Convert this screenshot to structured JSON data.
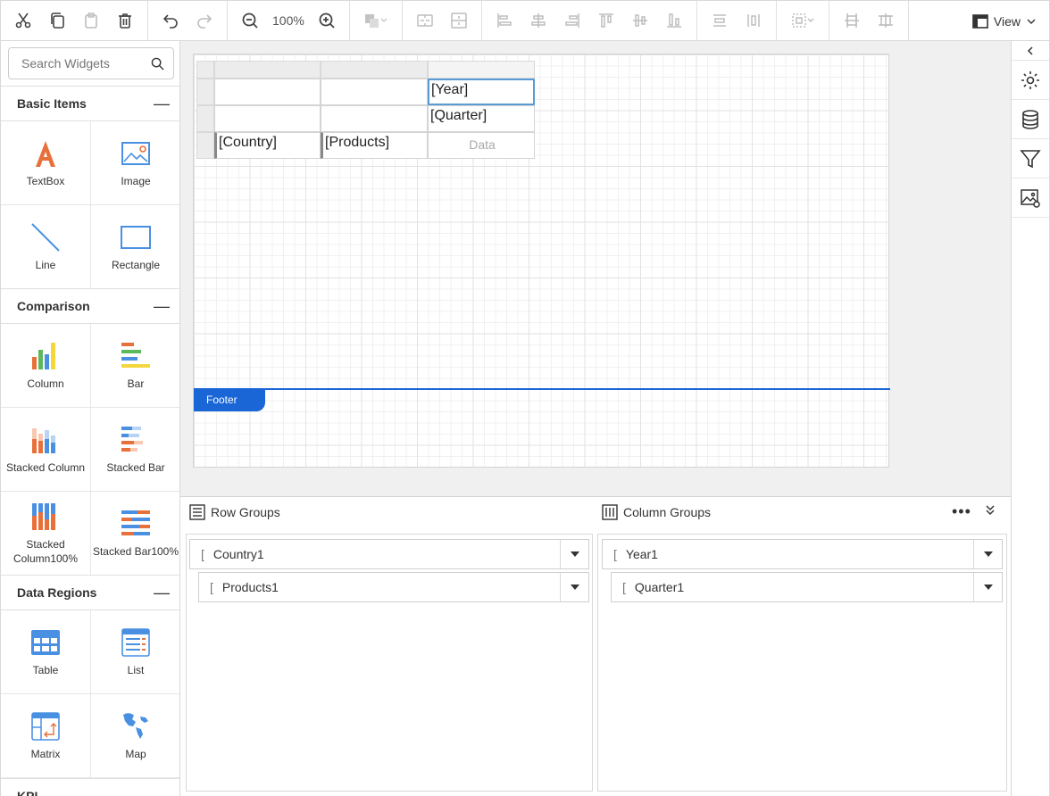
{
  "toolbar": {
    "zoom": "100%",
    "view_label": "View",
    "icons": [
      "cut-icon",
      "copy-icon",
      "paste-icon",
      "delete-icon",
      "undo-icon",
      "redo-icon",
      "zoom-out-icon",
      "zoom-in-icon",
      "fill-icon",
      "merge-icon",
      "split-icon",
      "align-left-icon",
      "align-center-icon",
      "align-right-icon",
      "align-top-icon",
      "align-middle-icon",
      "align-bottom-icon",
      "distribute-horizontal-icon",
      "distribute-vertical-icon",
      "sizing-icon",
      "center-horizontal-icon",
      "center-vertical-icon",
      "view-icon"
    ]
  },
  "left_panel": {
    "search_placeholder": "Search Widgets",
    "sections": [
      {
        "title": "Basic Items",
        "items": [
          "TextBox",
          "Image",
          "Line",
          "Rectangle"
        ]
      },
      {
        "title": "Comparison",
        "items": [
          "Column",
          "Bar",
          "Stacked Column",
          "Stacked Bar",
          "Stacked Column100%",
          "Stacked Bar100%"
        ]
      },
      {
        "title": "Data Regions",
        "items": [
          "Table",
          "List",
          "Matrix",
          "Map"
        ]
      },
      {
        "title": "KPI"
      }
    ]
  },
  "design": {
    "matrix": {
      "year_cell": "[Year]",
      "quarter_cell": "[Quarter]",
      "country_cell": "[Country]",
      "products_cell": "[Products]",
      "data_placeholder": "Data"
    },
    "footer_label": "Footer"
  },
  "right_panel": {
    "icons": [
      "collapse-arrow-icon",
      "settings-icon",
      "data-source-icon",
      "filter-icon",
      "image-manager-icon"
    ]
  },
  "groups": {
    "row_title": "Row Groups",
    "column_title": "Column Groups",
    "row_items": [
      "Country1",
      "Products1"
    ],
    "column_items": [
      "Year1",
      "Quarter1"
    ],
    "more_label": "•••"
  },
  "colors": {
    "accent": "#1a66d6",
    "selection": "#5b9bd5",
    "textbox_icon": "#e8703a",
    "chart_blue": "#4a90e2",
    "chart_green": "#5cb85c",
    "chart_orange": "#e8703a",
    "chart_yellow": "#f5d63d"
  }
}
